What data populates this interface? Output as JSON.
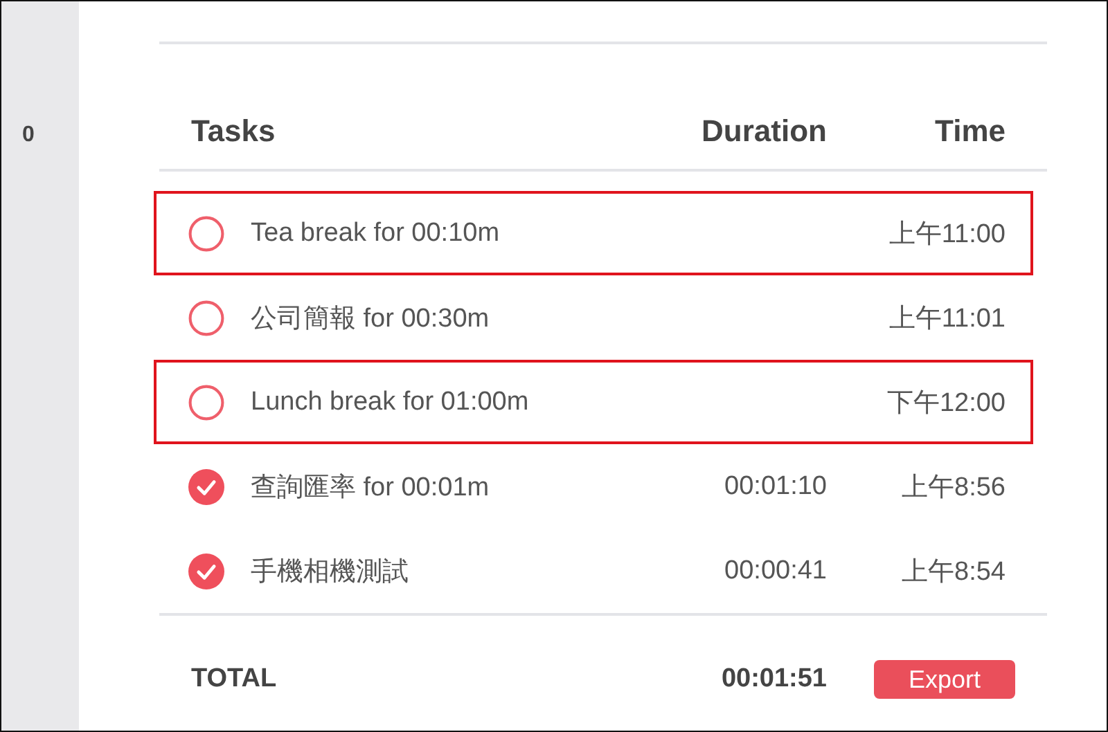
{
  "sidebar": {
    "count": "0"
  },
  "table": {
    "columns": [
      "Tasks",
      "Duration",
      "Time"
    ],
    "rows": [
      {
        "task": "Tea break for 00:10m",
        "time": "上午11:00",
        "done": false,
        "highlighted": true
      },
      {
        "task": "公司簡報 for 00:30m",
        "time": "上午11:01",
        "done": false,
        "highlighted": false
      },
      {
        "task": "Lunch break for 01:00m",
        "time": "下午12:00",
        "done": false,
        "highlighted": true
      },
      {
        "task": "查詢匯率 for 00:01m",
        "duration": "00:01:10",
        "time": "上午8:56",
        "done": true,
        "highlighted": false
      },
      {
        "task": "手機相機測試",
        "duration": "00:00:41",
        "time": "上午8:54",
        "done": true,
        "highlighted": false
      }
    ]
  },
  "total": {
    "label": "TOTAL",
    "duration": "00:01:51"
  },
  "export_button": "Export"
}
